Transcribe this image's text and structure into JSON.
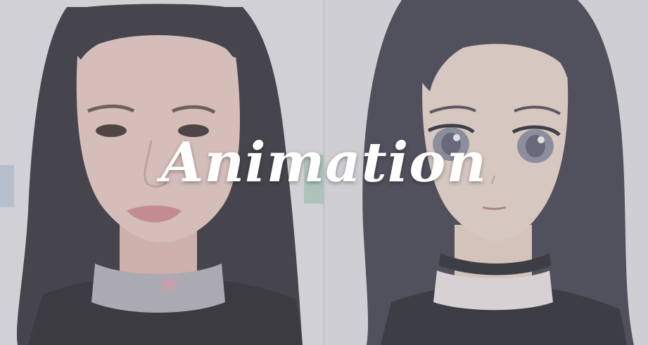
{
  "overlay": {
    "title": "Animation"
  },
  "panels": {
    "left": {
      "icon": "photo-portrait-icon"
    },
    "right": {
      "icon": "anime-portrait-icon"
    }
  },
  "colors": {
    "background": "#e9e9eb",
    "title_text": "#ffffff",
    "hair": "#2b2a31",
    "skin_photo": "#f1d2c6",
    "skin_anime": "#f3e0d0"
  }
}
